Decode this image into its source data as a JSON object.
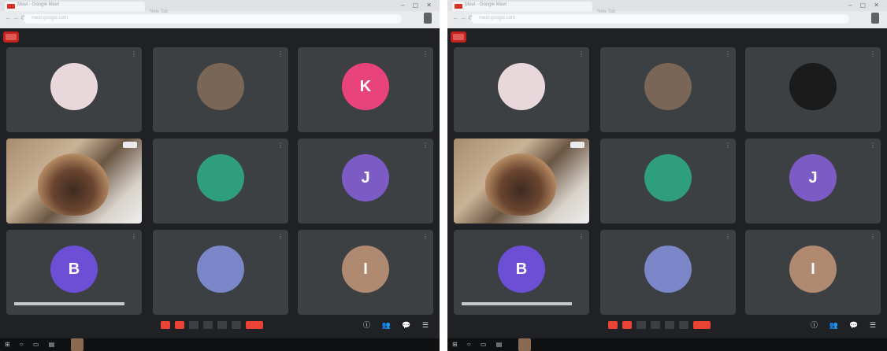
{
  "screenshots": [
    {
      "tab_title": "Meet - Google Meet",
      "tab2_title": "New Tab",
      "url": "meet.google.com",
      "meeting_info": "",
      "tiles": [
        {
          "name": "",
          "kind": "avatar",
          "color": "#e8d8dc",
          "initial": ""
        },
        {
          "name": "",
          "kind": "avatar",
          "color": "#7a6656",
          "initial": ""
        },
        {
          "name": "",
          "kind": "avatar",
          "color": "#e8437a",
          "initial": "K"
        },
        {
          "name": "",
          "kind": "video"
        },
        {
          "name": "",
          "kind": "avatar",
          "color": "#2f9e7a",
          "initial": ""
        },
        {
          "name": "",
          "kind": "avatar",
          "color": "#7c5cc4",
          "initial": "J"
        },
        {
          "name": "",
          "kind": "avatar",
          "color": "#6c4fd4",
          "initial": "B"
        },
        {
          "name": "",
          "kind": "avatar",
          "color": "#7a86c8",
          "initial": ""
        },
        {
          "name": "",
          "kind": "avatar",
          "color": "#b08a70",
          "initial": "I"
        }
      ]
    },
    {
      "tab_title": "Meet - Google Meet",
      "tab2_title": "New Tab",
      "url": "meet.google.com",
      "meeting_info": "",
      "tiles": [
        {
          "name": "",
          "kind": "avatar",
          "color": "#e8d8dc",
          "initial": ""
        },
        {
          "name": "",
          "kind": "avatar",
          "color": "#7a6656",
          "initial": ""
        },
        {
          "name": "",
          "kind": "avatar",
          "color": "#1b1b1b",
          "initial": ""
        },
        {
          "name": "",
          "kind": "video"
        },
        {
          "name": "",
          "kind": "avatar",
          "color": "#2f9e7a",
          "initial": ""
        },
        {
          "name": "",
          "kind": "avatar",
          "color": "#7c5cc4",
          "initial": "J"
        },
        {
          "name": "",
          "kind": "avatar",
          "color": "#6c4fd4",
          "initial": "B"
        },
        {
          "name": "",
          "kind": "avatar",
          "color": "#7a86c8",
          "initial": ""
        },
        {
          "name": "",
          "kind": "avatar",
          "color": "#b08a70",
          "initial": "I"
        }
      ]
    }
  ],
  "icons": {
    "more": "⋮",
    "nav": "← → ⟳",
    "window_controls": "– ▢ ✕",
    "right_tools": "ⓘ 👥 💬 ☰",
    "taskbar": "⊞ ○ ▭ ▤"
  },
  "taskbar_right": "",
  "colors": {
    "background": "#202124",
    "tile": "#3c4043",
    "end_call": "#ea4335"
  }
}
